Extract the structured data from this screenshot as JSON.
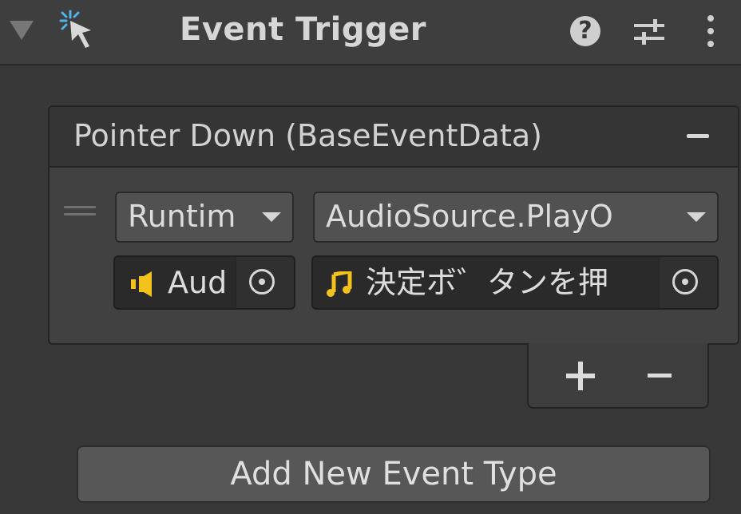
{
  "header": {
    "title": "Event Trigger",
    "help_glyph": "?",
    "icons": [
      "foldout-triangle-icon",
      "event-trigger-icon",
      "help-icon",
      "preset-icon",
      "context-menu-icon"
    ]
  },
  "event": {
    "title": "Pointer Down (BaseEventData)",
    "runtime_dropdown": "Runtim",
    "function_dropdown": "AudioSource.PlayO",
    "target_object": "Aud",
    "argument_object": "決定ボ゛タンを押"
  },
  "add_event_button": "Add New Event Type",
  "colors": {
    "background": "#383838",
    "audio_icon": "#f3c21c",
    "event_icon": "#4fb3e8"
  }
}
